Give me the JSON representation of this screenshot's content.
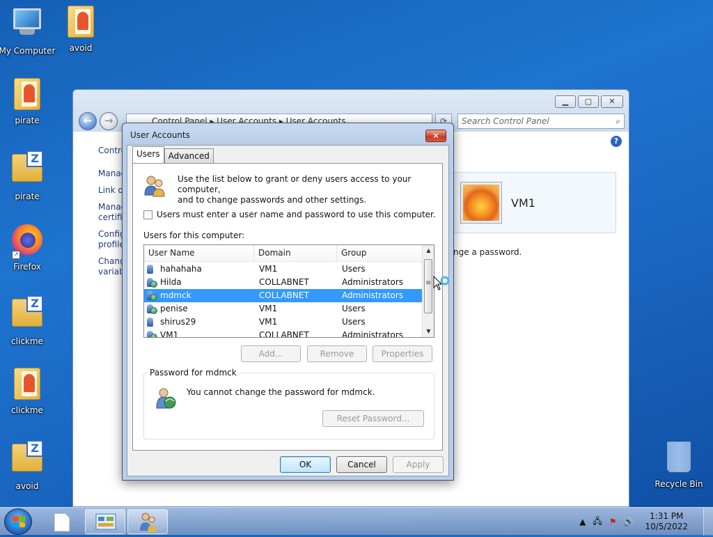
{
  "desktop": {
    "icons": [
      {
        "label": "My Computer",
        "icon": "computer-icon"
      },
      {
        "label": "avoid",
        "icon": "pdf-folder-icon"
      },
      {
        "label": "pirate",
        "icon": "pdf-folder-icon"
      },
      {
        "label": "pirate",
        "icon": "zip-file-icon"
      },
      {
        "label": "Firefox",
        "icon": "firefox-icon"
      },
      {
        "label": "clickme",
        "icon": "zip-file-icon"
      },
      {
        "label": "clickme",
        "icon": "pdf-folder-icon"
      },
      {
        "label": "avoid",
        "icon": "zip-file-icon"
      },
      {
        "label": "Recycle Bin",
        "icon": "recycle-bin-icon"
      }
    ]
  },
  "control_panel": {
    "breadcrumb": "Control Panel  ▸  User Accounts  ▸  User Accounts",
    "search_placeholder": "Search Control Panel",
    "left_links": [
      "Contro",
      "Manag",
      "Link or",
      "Manag certific",
      "Config profile",
      "Chang variab"
    ],
    "user_name": "VM1",
    "snippet": "nge a password."
  },
  "dialog": {
    "title": "User Accounts",
    "tabs": [
      "Users",
      "Advanced"
    ],
    "intro_line1": "Use the list below to grant or deny users access to your computer,",
    "intro_line2": "and to change passwords and other settings.",
    "require_login_label": "Users must enter a user name and password to use this computer.",
    "require_login_checked": false,
    "users_label": "Users for this computer:",
    "columns": [
      "User Name",
      "Domain",
      "Group"
    ],
    "users": [
      {
        "name": "hahahaha",
        "domain": "VM1",
        "group": "Users"
      },
      {
        "name": "Hilda",
        "domain": "COLLABNET",
        "group": "Administrators"
      },
      {
        "name": "mdmck",
        "domain": "COLLABNET",
        "group": "Administrators"
      },
      {
        "name": "penise",
        "domain": "VM1",
        "group": "Users"
      },
      {
        "name": "shirus29",
        "domain": "VM1",
        "group": "Users"
      },
      {
        "name": "VM1",
        "domain": "COLLABNET",
        "group": "Administrators"
      }
    ],
    "selected_user": "mdmck",
    "buttons": {
      "add": "Add...",
      "remove": "Remove",
      "properties": "Properties"
    },
    "password_group_title": "Password for mdmck",
    "password_text": "You cannot change the password for mdmck.",
    "reset_password": "Reset Password...",
    "ok": "OK",
    "cancel": "Cancel",
    "apply": "Apply"
  },
  "taskbar": {
    "time": "1:31 PM",
    "date": "10/5/2022"
  }
}
